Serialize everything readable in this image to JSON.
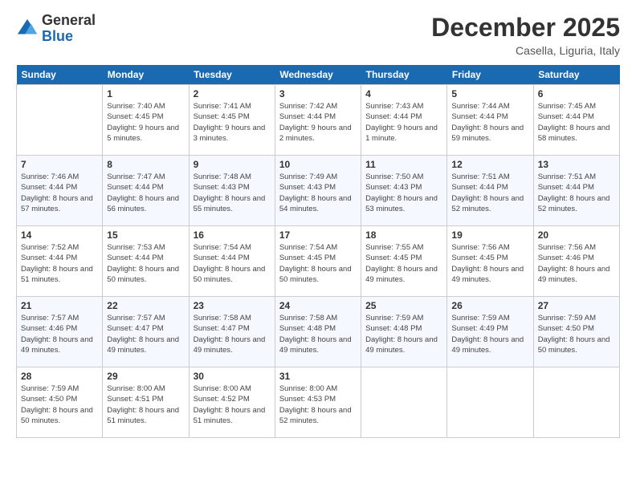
{
  "logo": {
    "general": "General",
    "blue": "Blue"
  },
  "title": "December 2025",
  "location": "Casella, Liguria, Italy",
  "weekdays": [
    "Sunday",
    "Monday",
    "Tuesday",
    "Wednesday",
    "Thursday",
    "Friday",
    "Saturday"
  ],
  "weeks": [
    [
      {
        "day": "",
        "sunrise": "",
        "sunset": "",
        "daylight": ""
      },
      {
        "day": "1",
        "sunrise": "Sunrise: 7:40 AM",
        "sunset": "Sunset: 4:45 PM",
        "daylight": "Daylight: 9 hours and 5 minutes."
      },
      {
        "day": "2",
        "sunrise": "Sunrise: 7:41 AM",
        "sunset": "Sunset: 4:45 PM",
        "daylight": "Daylight: 9 hours and 3 minutes."
      },
      {
        "day": "3",
        "sunrise": "Sunrise: 7:42 AM",
        "sunset": "Sunset: 4:44 PM",
        "daylight": "Daylight: 9 hours and 2 minutes."
      },
      {
        "day": "4",
        "sunrise": "Sunrise: 7:43 AM",
        "sunset": "Sunset: 4:44 PM",
        "daylight": "Daylight: 9 hours and 1 minute."
      },
      {
        "day": "5",
        "sunrise": "Sunrise: 7:44 AM",
        "sunset": "Sunset: 4:44 PM",
        "daylight": "Daylight: 8 hours and 59 minutes."
      },
      {
        "day": "6",
        "sunrise": "Sunrise: 7:45 AM",
        "sunset": "Sunset: 4:44 PM",
        "daylight": "Daylight: 8 hours and 58 minutes."
      }
    ],
    [
      {
        "day": "7",
        "sunrise": "Sunrise: 7:46 AM",
        "sunset": "Sunset: 4:44 PM",
        "daylight": "Daylight: 8 hours and 57 minutes."
      },
      {
        "day": "8",
        "sunrise": "Sunrise: 7:47 AM",
        "sunset": "Sunset: 4:44 PM",
        "daylight": "Daylight: 8 hours and 56 minutes."
      },
      {
        "day": "9",
        "sunrise": "Sunrise: 7:48 AM",
        "sunset": "Sunset: 4:43 PM",
        "daylight": "Daylight: 8 hours and 55 minutes."
      },
      {
        "day": "10",
        "sunrise": "Sunrise: 7:49 AM",
        "sunset": "Sunset: 4:43 PM",
        "daylight": "Daylight: 8 hours and 54 minutes."
      },
      {
        "day": "11",
        "sunrise": "Sunrise: 7:50 AM",
        "sunset": "Sunset: 4:43 PM",
        "daylight": "Daylight: 8 hours and 53 minutes."
      },
      {
        "day": "12",
        "sunrise": "Sunrise: 7:51 AM",
        "sunset": "Sunset: 4:44 PM",
        "daylight": "Daylight: 8 hours and 52 minutes."
      },
      {
        "day": "13",
        "sunrise": "Sunrise: 7:51 AM",
        "sunset": "Sunset: 4:44 PM",
        "daylight": "Daylight: 8 hours and 52 minutes."
      }
    ],
    [
      {
        "day": "14",
        "sunrise": "Sunrise: 7:52 AM",
        "sunset": "Sunset: 4:44 PM",
        "daylight": "Daylight: 8 hours and 51 minutes."
      },
      {
        "day": "15",
        "sunrise": "Sunrise: 7:53 AM",
        "sunset": "Sunset: 4:44 PM",
        "daylight": "Daylight: 8 hours and 50 minutes."
      },
      {
        "day": "16",
        "sunrise": "Sunrise: 7:54 AM",
        "sunset": "Sunset: 4:44 PM",
        "daylight": "Daylight: 8 hours and 50 minutes."
      },
      {
        "day": "17",
        "sunrise": "Sunrise: 7:54 AM",
        "sunset": "Sunset: 4:45 PM",
        "daylight": "Daylight: 8 hours and 50 minutes."
      },
      {
        "day": "18",
        "sunrise": "Sunrise: 7:55 AM",
        "sunset": "Sunset: 4:45 PM",
        "daylight": "Daylight: 8 hours and 49 minutes."
      },
      {
        "day": "19",
        "sunrise": "Sunrise: 7:56 AM",
        "sunset": "Sunset: 4:45 PM",
        "daylight": "Daylight: 8 hours and 49 minutes."
      },
      {
        "day": "20",
        "sunrise": "Sunrise: 7:56 AM",
        "sunset": "Sunset: 4:46 PM",
        "daylight": "Daylight: 8 hours and 49 minutes."
      }
    ],
    [
      {
        "day": "21",
        "sunrise": "Sunrise: 7:57 AM",
        "sunset": "Sunset: 4:46 PM",
        "daylight": "Daylight: 8 hours and 49 minutes."
      },
      {
        "day": "22",
        "sunrise": "Sunrise: 7:57 AM",
        "sunset": "Sunset: 4:47 PM",
        "daylight": "Daylight: 8 hours and 49 minutes."
      },
      {
        "day": "23",
        "sunrise": "Sunrise: 7:58 AM",
        "sunset": "Sunset: 4:47 PM",
        "daylight": "Daylight: 8 hours and 49 minutes."
      },
      {
        "day": "24",
        "sunrise": "Sunrise: 7:58 AM",
        "sunset": "Sunset: 4:48 PM",
        "daylight": "Daylight: 8 hours and 49 minutes."
      },
      {
        "day": "25",
        "sunrise": "Sunrise: 7:59 AM",
        "sunset": "Sunset: 4:48 PM",
        "daylight": "Daylight: 8 hours and 49 minutes."
      },
      {
        "day": "26",
        "sunrise": "Sunrise: 7:59 AM",
        "sunset": "Sunset: 4:49 PM",
        "daylight": "Daylight: 8 hours and 49 minutes."
      },
      {
        "day": "27",
        "sunrise": "Sunrise: 7:59 AM",
        "sunset": "Sunset: 4:50 PM",
        "daylight": "Daylight: 8 hours and 50 minutes."
      }
    ],
    [
      {
        "day": "28",
        "sunrise": "Sunrise: 7:59 AM",
        "sunset": "Sunset: 4:50 PM",
        "daylight": "Daylight: 8 hours and 50 minutes."
      },
      {
        "day": "29",
        "sunrise": "Sunrise: 8:00 AM",
        "sunset": "Sunset: 4:51 PM",
        "daylight": "Daylight: 8 hours and 51 minutes."
      },
      {
        "day": "30",
        "sunrise": "Sunrise: 8:00 AM",
        "sunset": "Sunset: 4:52 PM",
        "daylight": "Daylight: 8 hours and 51 minutes."
      },
      {
        "day": "31",
        "sunrise": "Sunrise: 8:00 AM",
        "sunset": "Sunset: 4:53 PM",
        "daylight": "Daylight: 8 hours and 52 minutes."
      },
      {
        "day": "",
        "sunrise": "",
        "sunset": "",
        "daylight": ""
      },
      {
        "day": "",
        "sunrise": "",
        "sunset": "",
        "daylight": ""
      },
      {
        "day": "",
        "sunrise": "",
        "sunset": "",
        "daylight": ""
      }
    ]
  ]
}
